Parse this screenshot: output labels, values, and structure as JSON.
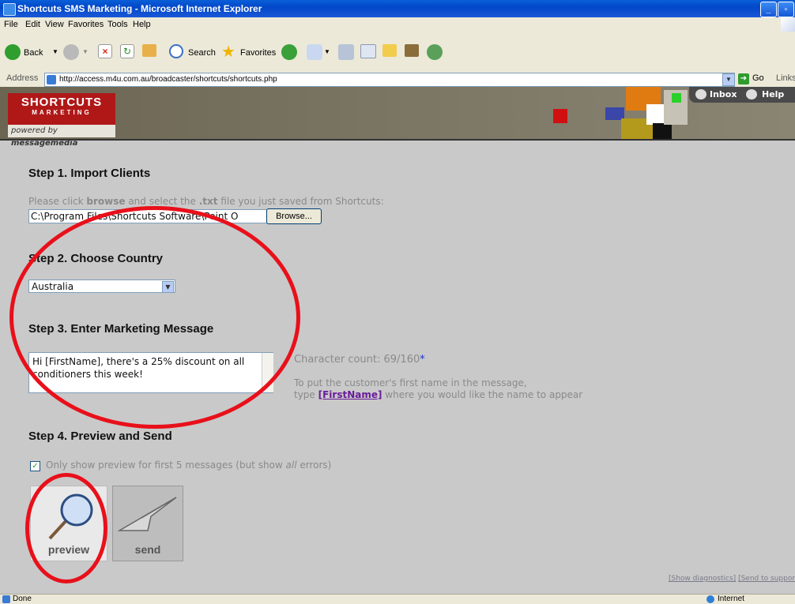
{
  "window": {
    "title": "Shortcuts SMS Marketing - Microsoft Internet Explorer"
  },
  "menu": [
    "File",
    "Edit",
    "View",
    "Favorites",
    "Tools",
    "Help"
  ],
  "toolbar": {
    "back_label": "Back",
    "search_label": "Search",
    "favorites_label": "Favorites"
  },
  "address": {
    "label": "Address",
    "url": "http://access.m4u.com.au/broadcaster/shortcuts/shortcuts.php",
    "go_label": "Go",
    "links_label": "Links"
  },
  "banner": {
    "logo_line1": "SHORTCUTS",
    "logo_line2": "MARKETING",
    "powered_prefix": "powered by ",
    "powered_brand": "messagemedia",
    "inbox_label": "Inbox",
    "help_label": "Help"
  },
  "step1": {
    "heading": "Step 1. Import Clients",
    "instruction_pre": "Please click ",
    "instruction_bold1": "browse",
    "instruction_mid": " and select the ",
    "instruction_bold2": ".txt",
    "instruction_post": " file you just saved from Shortcuts:",
    "file_value": "C:\\Program Files\\Shortcuts Software\\Point O",
    "browse_label": "Browse..."
  },
  "step2": {
    "heading": "Step 2. Choose Country",
    "country_value": "Australia"
  },
  "step3": {
    "heading": "Step 3. Enter Marketing Message",
    "message_value": "Hi [FirstName], there's a 25% discount on all conditioners this week!",
    "char_count_label": "Character count: 69/160",
    "asterisk": "*",
    "tip_line1": "To put the customer's first name in the message,",
    "tip_line2_pre": "type ",
    "tip_token": "[FirstName]",
    "tip_line2_post": " where you would like the name to appear"
  },
  "step4": {
    "heading": "Step 4. Preview and Send",
    "preview_only_pre": "Only show preview for first 5 messages (but show ",
    "preview_only_em": "all",
    "preview_only_post": " errors)",
    "preview_only_checked": true,
    "preview_label": "preview",
    "send_label": "send"
  },
  "footer": {
    "diagnostics_link": "[Show diagnostics]",
    "support_link": "[Send to support]"
  },
  "status": {
    "text": "Done",
    "zone": "Internet"
  },
  "colors": {
    "annotation_red": "#e8101a",
    "link_purple": "#6a1b9a",
    "xp_blue": "#0a5fd8"
  }
}
